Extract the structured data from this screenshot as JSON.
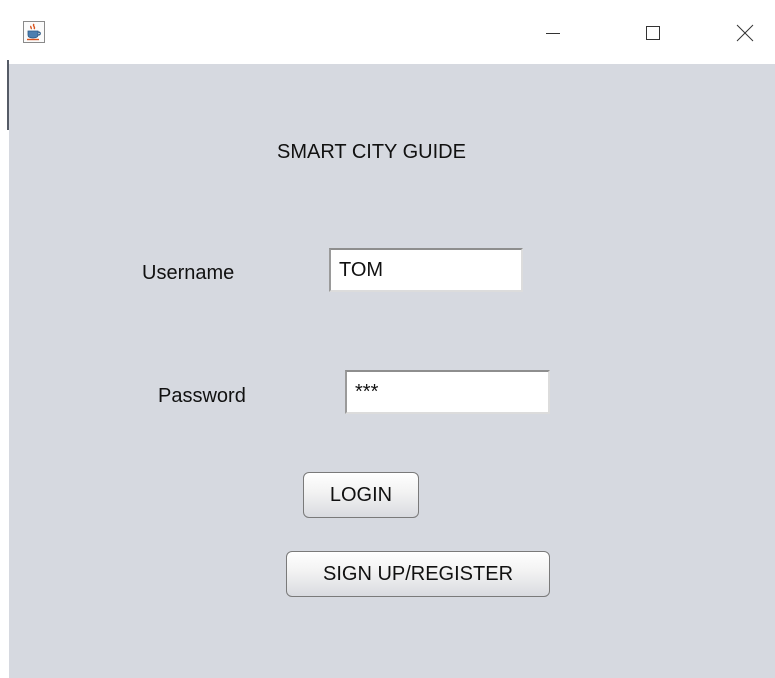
{
  "window": {
    "icon": "java-cup-icon",
    "controls": {
      "minimize_icon": "minimize-icon",
      "maximize_icon": "maximize-icon",
      "close_icon": "close-icon"
    }
  },
  "app": {
    "title": "SMART CITY GUIDE"
  },
  "form": {
    "username_label": "Username",
    "username_value": "TOM",
    "password_label": "Password",
    "password_value": "***"
  },
  "buttons": {
    "login_label": "LOGIN",
    "signup_label": "SIGN UP/REGISTER"
  },
  "colors": {
    "panel_background": "#d6d9e0",
    "titlebar_background": "#ffffff"
  }
}
